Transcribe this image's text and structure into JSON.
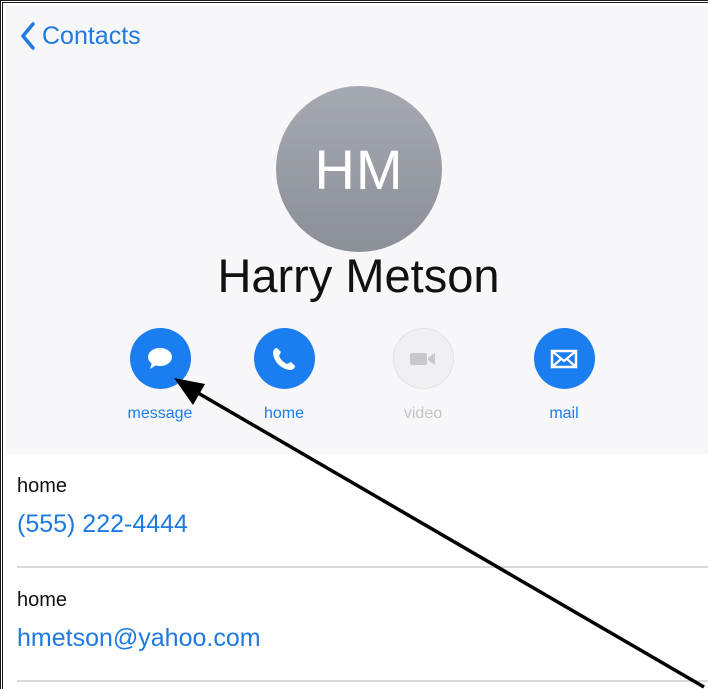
{
  "nav": {
    "back_label": "Contacts"
  },
  "contact": {
    "initials": "HM",
    "name": "Harry Metson"
  },
  "actions": [
    {
      "label": "message",
      "icon": "message-icon",
      "enabled": true
    },
    {
      "label": "home",
      "icon": "phone-icon",
      "enabled": true
    },
    {
      "label": "video",
      "icon": "video-icon",
      "enabled": false
    },
    {
      "label": "mail",
      "icon": "mail-icon",
      "enabled": true
    }
  ],
  "fields": [
    {
      "kind": "home",
      "value": "(555) 222-4444"
    },
    {
      "kind": "home",
      "value": "hmetson@yahoo.com"
    }
  ],
  "colors": {
    "accent": "#1a7df0",
    "link": "#1e7ae0",
    "avatar": "#9a9da5",
    "header_bg": "#f7f7f9"
  }
}
